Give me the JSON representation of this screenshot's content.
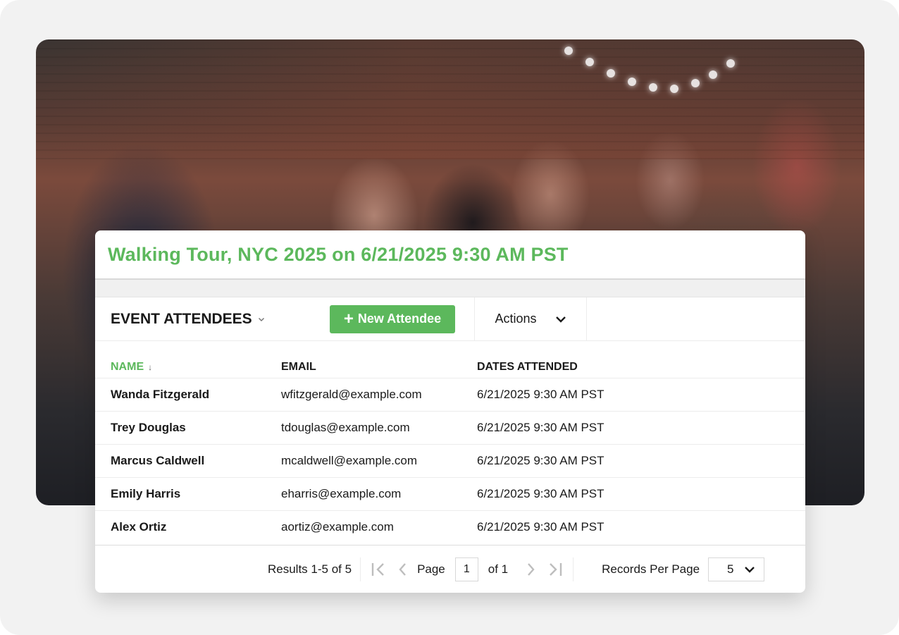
{
  "event": {
    "title": "Walking Tour, NYC 2025 on 6/21/2025 9:30 AM PST"
  },
  "toolbar": {
    "section_title": "EVENT ATTENDEES",
    "new_button_label": "New Attendee",
    "actions_label": "Actions"
  },
  "table": {
    "columns": [
      "NAME",
      "EMAIL",
      "DATES ATTENDED"
    ],
    "sorted_column": "NAME",
    "rows": [
      {
        "name": "Wanda Fitzgerald",
        "email": "wfitzgerald@example.com",
        "dates": "6/21/2025 9:30 AM PST"
      },
      {
        "name": "Trey Douglas",
        "email": "tdouglas@example.com",
        "dates": "6/21/2025 9:30 AM PST"
      },
      {
        "name": "Marcus Caldwell",
        "email": "mcaldwell@example.com",
        "dates": "6/21/2025 9:30 AM PST"
      },
      {
        "name": "Emily Harris",
        "email": "eharris@example.com",
        "dates": "6/21/2025 9:30 AM PST"
      },
      {
        "name": "Alex Ortiz",
        "email": "aortiz@example.com",
        "dates": "6/21/2025 9:30 AM PST"
      }
    ]
  },
  "pagination": {
    "results_label": "Results 1-5  of 5",
    "page_label": "Page",
    "current_page": "1",
    "of_label": "of 1",
    "rpp_label": "Records Per Page",
    "rpp_value": "5"
  },
  "colors": {
    "accent": "#5cb85c",
    "text": "#1a1a1a",
    "disabled_nav": "#bdbdbd"
  },
  "icons": {
    "section_menu": "chevron-down-icon",
    "new_button": "plus-icon",
    "actions": "chevron-down-icon",
    "sort": "arrow-down-icon",
    "first": "first-page-icon",
    "prev": "chevron-left-icon",
    "next": "chevron-right-icon",
    "last": "last-page-icon",
    "rpp": "chevron-down-icon"
  }
}
